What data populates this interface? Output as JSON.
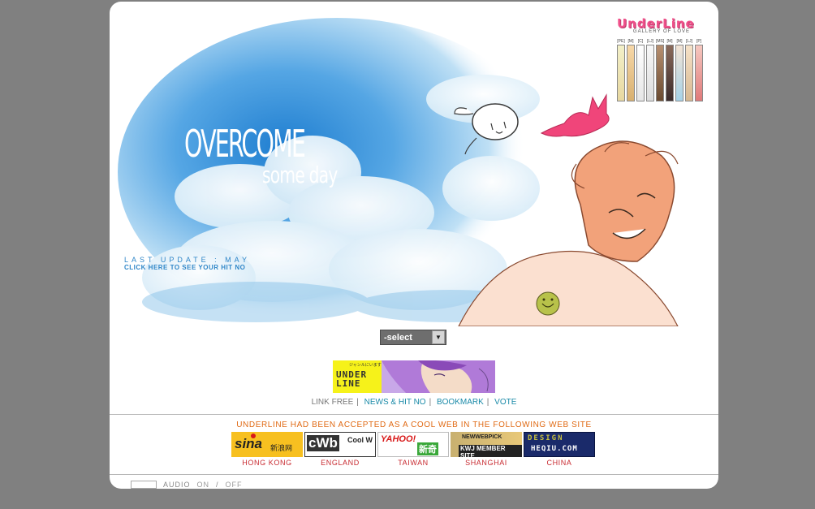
{
  "logo": {
    "title": "UnderLine",
    "subtitle": "GALLERY OF LOVE"
  },
  "character_labels": [
    "[PE]",
    "[M]",
    "[C]",
    "[LJ]",
    "[MS]",
    "[M]",
    "[M]",
    "[LJ]",
    "[P]"
  ],
  "headline": {
    "line1": "OVERCOME",
    "line2": "some day"
  },
  "update_text": "LAST UPDATE : MAY",
  "hit_link": "CLICK HERE TO SEE YOUR HIT NO",
  "select": {
    "value": "-select"
  },
  "banner": {
    "text_line1": "UNDER",
    "text_line2": "LINE",
    "jp": "ジャンルにいます"
  },
  "links": {
    "link_free": "LINK FREE",
    "news": "NEWS & HIT NO",
    "bookmark": "BOOKMARK",
    "vote": "VOTE"
  },
  "cool_web": "UNDERLINE HAD BEEN ACCEPTED AS A COOL WEB IN THE FOLLOWING WEB SITE",
  "sites": [
    {
      "name": "sina",
      "tag": "新浪网",
      "label": "HONG KONG"
    },
    {
      "name": "cWb",
      "tag": "Cool W",
      "label": "ENGLAND"
    },
    {
      "name": "YAHOO!",
      "tag": "新奇",
      "label": "TAIWAN"
    },
    {
      "name": "NEWWEBPICK",
      "tag": "KWJ MEMBER SITE",
      "label": "SHANGHAI"
    },
    {
      "name": "DESIGN",
      "tag": "HEQIU.COM",
      "label": "CHINA"
    }
  ],
  "audio": {
    "label": "AUDIO",
    "on": "ON",
    "sep": "/",
    "off": "OFF"
  },
  "colors": {
    "accent": "#1a8aa8",
    "orange": "#e06a14",
    "red": "#c82a30",
    "sky": "#2f86c8"
  }
}
